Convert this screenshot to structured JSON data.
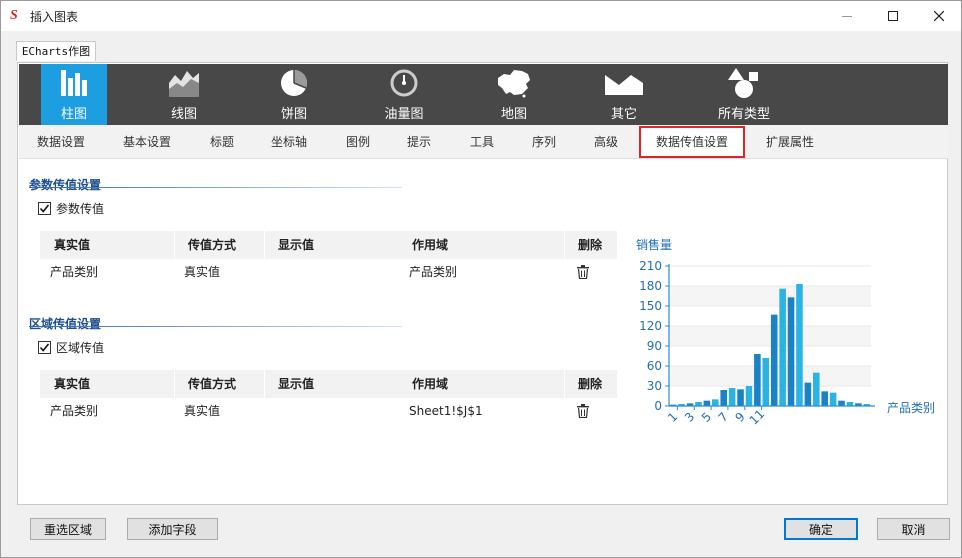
{
  "window": {
    "title": "插入图表",
    "doc_tab": "ECharts作图"
  },
  "chart_types": [
    {
      "label": "柱图",
      "icon": "bar-chart-icon",
      "active": true
    },
    {
      "label": "线图",
      "icon": "line-chart-icon",
      "active": false
    },
    {
      "label": "饼图",
      "icon": "pie-chart-icon",
      "active": false
    },
    {
      "label": "油量图",
      "icon": "gauge-icon",
      "active": false
    },
    {
      "label": "地图",
      "icon": "china-map-icon",
      "active": false
    },
    {
      "label": "其它",
      "icon": "other-chart-icon",
      "active": false
    },
    {
      "label": "所有类型",
      "icon": "shapes-icon",
      "active": false
    }
  ],
  "subtabs": [
    "数据设置",
    "基本设置",
    "标题",
    "坐标轴",
    "图例",
    "提示",
    "工具",
    "序列",
    "高级",
    "数据传值设置",
    "扩展属性"
  ],
  "selected_subtab": "数据传值设置",
  "param_section": {
    "title": "参数传值设置",
    "checkbox_label": "参数传值",
    "checked": true,
    "headers": [
      "真实值",
      "传值方式",
      "显示值",
      "作用域",
      "删除"
    ],
    "rows": [
      {
        "real": "产品类别",
        "method": "真实值",
        "display": "",
        "scope": "产品类别"
      }
    ]
  },
  "area_section": {
    "title": "区域传值设置",
    "checkbox_label": "区域传值",
    "checked": true,
    "headers": [
      "真实值",
      "传值方式",
      "显示值",
      "作用域",
      "删除"
    ],
    "rows": [
      {
        "real": "产品类别",
        "method": "真实值",
        "display": "",
        "scope": "Sheet1!$J$1"
      }
    ]
  },
  "buttons": {
    "reselect": "重选区域",
    "add_field": "添加字段",
    "ok": "确定",
    "cancel": "取消"
  },
  "colors": {
    "accent": "#1c9ee0",
    "bar_dark": "#1c82c6",
    "bar_light": "#2bb3e3",
    "axis": "#2b8ccf",
    "highlight": "#d9262b"
  },
  "chart_data": {
    "type": "bar",
    "ylabel": "销售量",
    "xlabel": "产品类别",
    "ylim": [
      0,
      210
    ],
    "yticks": [
      0,
      30,
      60,
      90,
      120,
      150,
      180,
      210
    ],
    "xtick_labels": [
      "1",
      "3",
      "5",
      "7",
      "9",
      "11"
    ],
    "values": [
      2,
      3,
      4,
      6,
      8,
      10,
      24,
      27,
      25,
      30,
      78,
      72,
      137,
      176,
      163,
      183,
      35,
      50,
      22,
      20,
      8,
      6,
      4,
      3
    ],
    "grid": true
  }
}
